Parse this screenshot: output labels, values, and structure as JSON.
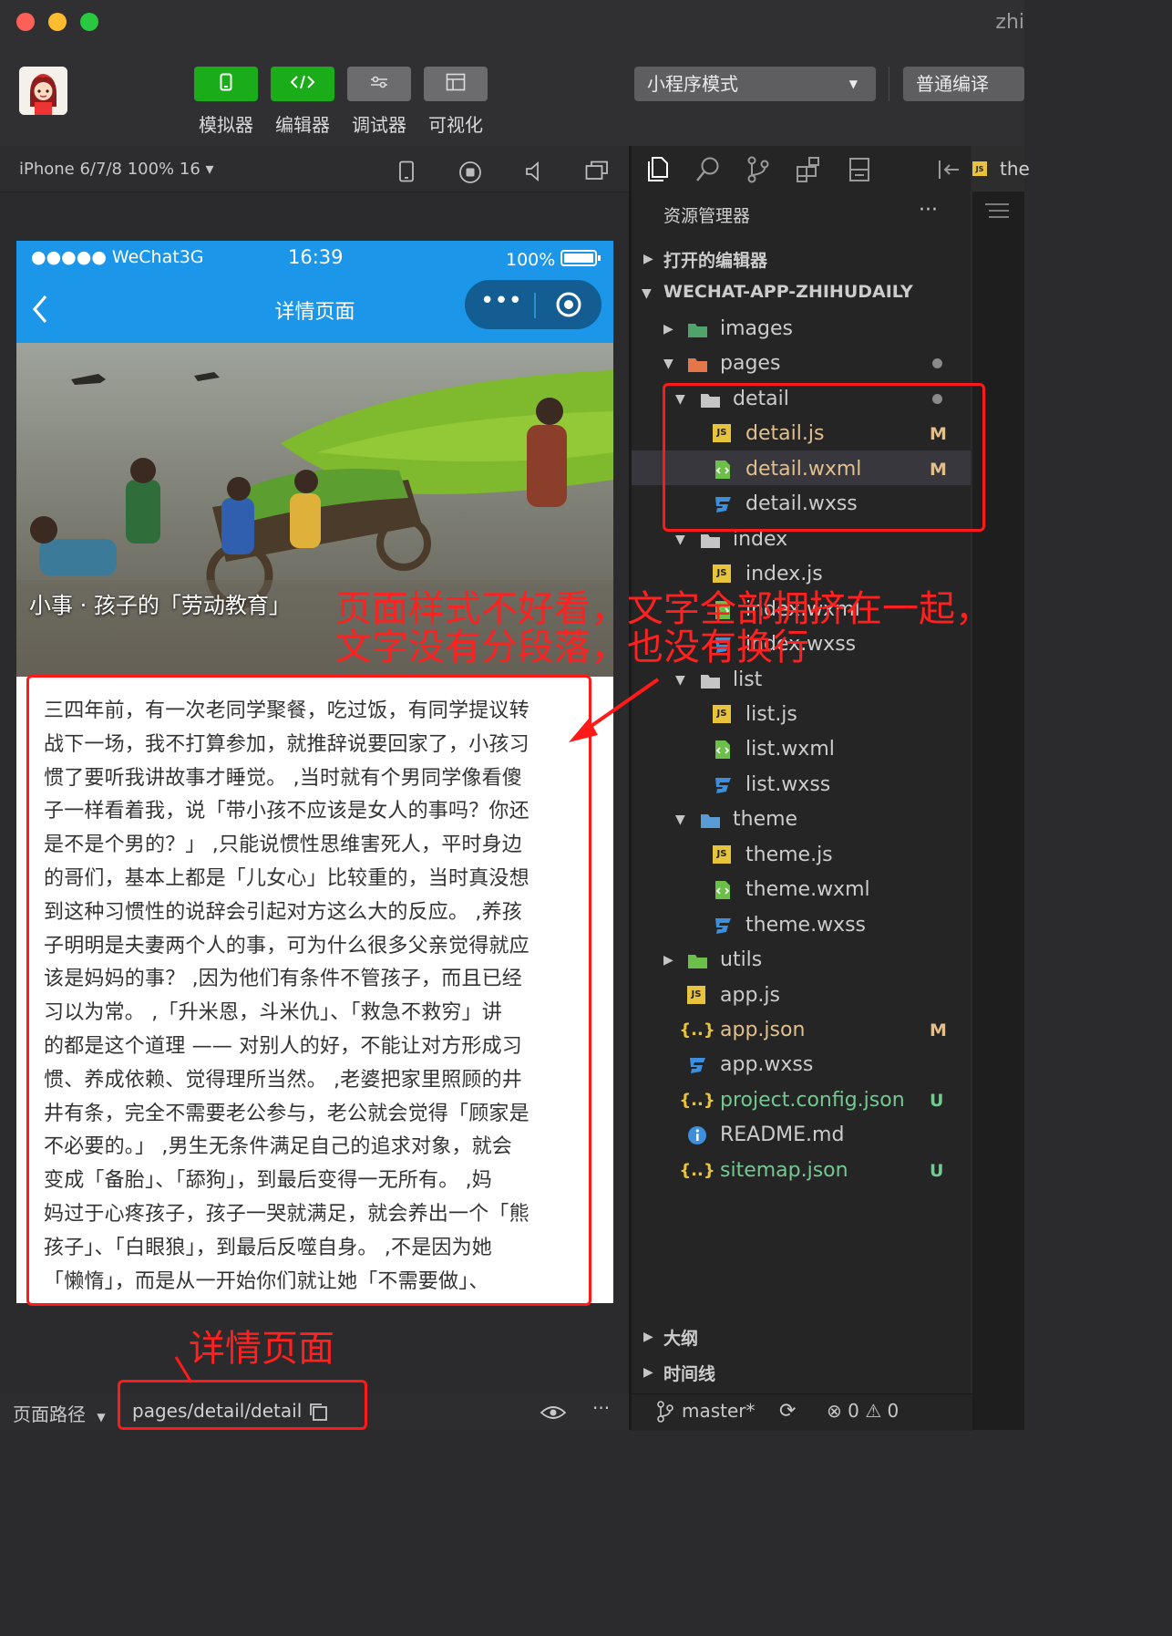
{
  "window": {
    "title": "zhi"
  },
  "toolbar": {
    "buttons": [
      {
        "label": "模拟器",
        "icon": "phone-icon"
      },
      {
        "label": "编辑器",
        "icon": "code-icon"
      },
      {
        "label": "调试器",
        "icon": "sliders-icon"
      },
      {
        "label": "可视化",
        "icon": "layout-icon"
      }
    ],
    "mode_select": "小程序模式",
    "compile_select": "普通编译"
  },
  "simulator": {
    "device": "iPhone 6/7/8 100% 16 ▾",
    "phone": {
      "carrier": "●●●●● WeChat3G",
      "time": "16:39",
      "battery": "100%",
      "nav_title": "详情页面",
      "capsule_more": "•••",
      "hero_title": "小事 · 孩子的「劳动教育」",
      "article_lines": [
        "三四年前，有一次老同学聚餐，吃过饭，有同学提议转",
        "战下一场，我不打算参加，就推辞说要回家了，小孩习",
        "惯了要听我讲故事才睡觉。 ,当时就有个男同学像看傻",
        "子一样看着我，说「带小孩不应该是女人的事吗？你还",
        "是不是个男的？」 ,只能说惯性思维害死人，平时身边",
        "的哥们，基本上都是「儿女心」比较重的，当时真没想",
        "到这种习惯性的说辞会引起对方这么大的反应。 ,养孩",
        "子明明是夫妻两个人的事，可为什么很多父亲觉得就应",
        "该是妈妈的事？ ,因为他们有条件不管孩子，而且已经",
        "习以为常。 ,「升米恩，斗米仇」、「救急不救穷」讲",
        "的都是这个道理 —— 对别人的好，不能让对方形成习",
        "惯、养成依赖、觉得理所当然。 ,老婆把家里照顾的井",
        "井有条，完全不需要老公参与，老公就会觉得「顾家是",
        "不必要的。」 ,男生无条件满足自己的追求对象，就会",
        "变成「备胎」、「舔狗」，到最后变得一无所有。 ,妈",
        "妈过于心疼孩子，孩子一哭就满足，就会养出一个「熊",
        "孩子」、「白眼狼」，到最后反噬自身。 ,不是因为她",
        "「懒惰」，而是从一开始你们就让她「不需要做」、"
      ]
    },
    "path_label": "页面路径",
    "path_value": "pages/detail/detail"
  },
  "annotations": {
    "main_line1": "页面样式不好看，文字全部拥挤在一起，",
    "main_line2": "文字没有分段落，也没有换行",
    "detail_page": "详情页面"
  },
  "explorer": {
    "title": "资源管理器",
    "more": "···",
    "open_editors": "打开的编辑器",
    "project": "WECHAT-APP-ZHIHUDAILY",
    "tree": [
      {
        "name": "images",
        "type": "folder",
        "depth": 1,
        "open": false
      },
      {
        "name": "pages",
        "type": "folder",
        "depth": 1,
        "open": true
      },
      {
        "name": "detail",
        "type": "folder",
        "depth": 2,
        "open": true
      },
      {
        "name": "detail.js",
        "type": "js",
        "depth": 3,
        "badge": "M"
      },
      {
        "name": "detail.wxml",
        "type": "wxml",
        "depth": 3,
        "badge": "M"
      },
      {
        "name": "detail.wxss",
        "type": "wxss",
        "depth": 3
      },
      {
        "name": "index",
        "type": "folder",
        "depth": 2,
        "open": true
      },
      {
        "name": "index.js",
        "type": "js",
        "depth": 3
      },
      {
        "name": "index.wxml",
        "type": "wxml",
        "depth": 3
      },
      {
        "name": "index.wxss",
        "type": "wxss",
        "depth": 3
      },
      {
        "name": "list",
        "type": "folder",
        "depth": 2,
        "open": true
      },
      {
        "name": "list.js",
        "type": "js",
        "depth": 3
      },
      {
        "name": "list.wxml",
        "type": "wxml",
        "depth": 3
      },
      {
        "name": "list.wxss",
        "type": "wxss",
        "depth": 3
      },
      {
        "name": "theme",
        "type": "folder",
        "depth": 2,
        "open": true
      },
      {
        "name": "theme.js",
        "type": "js",
        "depth": 3
      },
      {
        "name": "theme.wxml",
        "type": "wxml",
        "depth": 3
      },
      {
        "name": "theme.wxss",
        "type": "wxss",
        "depth": 3
      },
      {
        "name": "utils",
        "type": "folder",
        "depth": 1,
        "open": false
      },
      {
        "name": "app.js",
        "type": "js",
        "depth": 1
      },
      {
        "name": "app.json",
        "type": "json",
        "depth": 1,
        "badge": "M"
      },
      {
        "name": "app.wxss",
        "type": "wxss",
        "depth": 1
      },
      {
        "name": "project.config.json",
        "type": "json",
        "depth": 1,
        "badge": "U"
      },
      {
        "name": "README.md",
        "type": "info",
        "depth": 1
      },
      {
        "name": "sitemap.json",
        "type": "json",
        "depth": 1,
        "badge": "U"
      }
    ],
    "outline": "大纲",
    "timeline": "时间线"
  },
  "statusbar": {
    "branch": "master*",
    "errors": "0",
    "warnings": "0"
  },
  "editor_tab": "the",
  "colors": {
    "accent_green": "#1aad19",
    "nav_blue": "#1c96e8",
    "annotation_red": "#ff1a1a",
    "modified": "#e2c08d",
    "untracked": "#73c991"
  }
}
